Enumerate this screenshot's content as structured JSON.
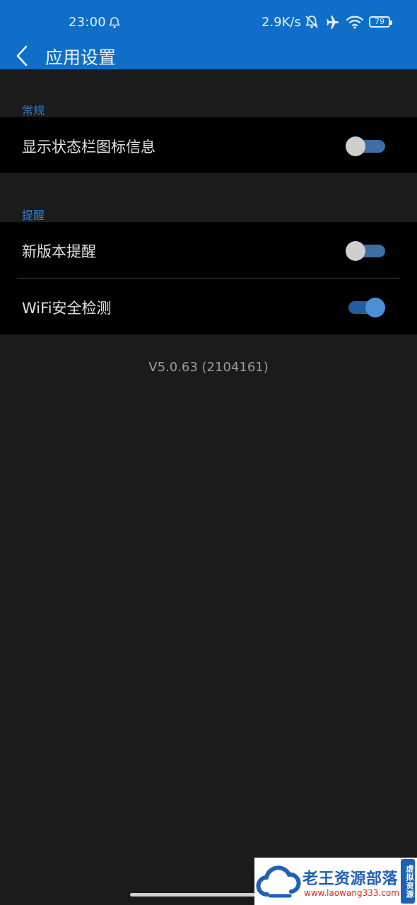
{
  "status_bar": {
    "time": "23:00",
    "net_speed": "2.9K/s",
    "battery": "79",
    "icons": [
      "notification-hd-icon",
      "bell-muted-icon",
      "airplane-icon",
      "wifi-icon",
      "battery-icon"
    ]
  },
  "header": {
    "title": "应用设置",
    "color": "#0f6fc8"
  },
  "sections": [
    {
      "label": "常规",
      "items": [
        {
          "label": "显示状态栏图标信息",
          "enabled": false
        }
      ]
    },
    {
      "label": "提醒",
      "items": [
        {
          "label": "新版本提醒",
          "enabled": false
        },
        {
          "label": "WiFi安全检测",
          "enabled": true
        }
      ]
    }
  ],
  "version": "V5.0.63 (2104161)",
  "watermark": {
    "title": "老王资源部落",
    "url": "www.laowang333.com",
    "badge": "虚拟资源"
  },
  "colors": {
    "accent": "#2f7bd0",
    "background": "#1b1b1b",
    "card": "#000000"
  }
}
